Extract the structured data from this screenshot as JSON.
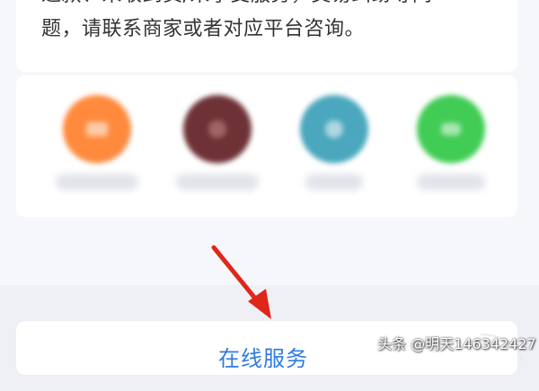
{
  "notice": {
    "line1": "退款、未收到货/未享受服务，交易纠纷等问",
    "line2": "题，请联系商家或者对应平台咨询。"
  },
  "services": [
    {
      "icon": "orange-service-icon",
      "color": "#ff8a3d"
    },
    {
      "icon": "maroon-service-icon",
      "color": "#6e3236"
    },
    {
      "icon": "teal-service-icon",
      "color": "#4aa7bd"
    },
    {
      "icon": "green-service-icon",
      "color": "#41cc55"
    }
  ],
  "bottom": {
    "online_service_label": "在线服务"
  },
  "watermark": {
    "text": "头条 @明天146342427"
  },
  "colors": {
    "accent": "#2f7be0",
    "arrow": "#e0261a"
  }
}
